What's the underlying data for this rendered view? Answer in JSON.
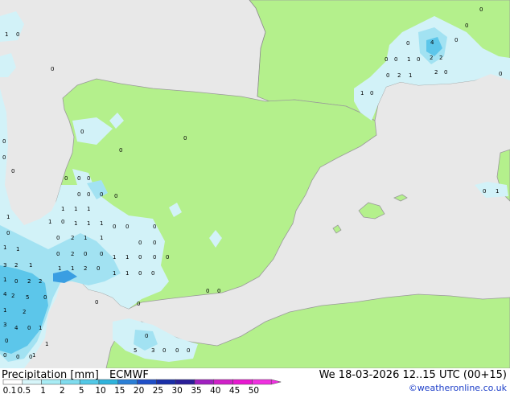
{
  "footer": {
    "title": "Precipitation [mm]",
    "model": "ECMWF",
    "datetime": "We 18-03-2026 12..15 UTC (00+15)",
    "copyright": "©weatheronline.co.uk"
  },
  "legend": {
    "values": [
      "0.1",
      "0.5",
      "1",
      "2",
      "5",
      "10",
      "15",
      "20",
      "25",
      "30",
      "35",
      "40",
      "45",
      "50"
    ],
    "colors": [
      "#ffffff",
      "#d7f5f9",
      "#a8ecf4",
      "#7fdcee",
      "#52c8e6",
      "#2eb3dc",
      "#2a7fd6",
      "#1f4fc8",
      "#1a2fa8",
      "#2a1e98",
      "#a020c0",
      "#d020c8",
      "#e818d0",
      "#f030e0"
    ]
  },
  "colors": {
    "land": "#b4f08c",
    "sea": "#e8e8e8",
    "precip_light": "#d2f2f8",
    "precip_mid": "#a2e2f2",
    "precip_heavy": "#5cc6ea",
    "precip_core": "#3a9ee2"
  },
  "map_values": [
    "1",
    "0",
    "0",
    "0",
    "0",
    "0",
    "0",
    "0",
    "4",
    "0",
    "0",
    "0",
    "0",
    "0",
    "0",
    "1",
    "0",
    "2",
    "2",
    "0",
    "0",
    "2",
    "2",
    "1",
    "1",
    "0",
    "0",
    "0",
    "1",
    "0",
    "0",
    "0",
    "0",
    "0",
    "0",
    "0",
    "1",
    "1",
    "1",
    "1",
    "0",
    "1",
    "1",
    "1",
    "1",
    "0",
    "0",
    "2",
    "1",
    "1",
    "0",
    "0",
    "0",
    "0",
    "0",
    "1",
    "1",
    "0",
    "2",
    "0",
    "0",
    "1",
    "1",
    "0",
    "0",
    "0",
    "1",
    "1",
    "2",
    "0",
    "1",
    "1",
    "0",
    "0",
    "0",
    "0",
    "0",
    "0",
    "1",
    "1",
    "2",
    "3",
    "4",
    "2",
    "0",
    "5",
    "2",
    "2",
    "0",
    "1",
    "2",
    "3",
    "4",
    "0",
    "1",
    "0",
    "0",
    "0",
    "0",
    "5",
    "3",
    "0",
    "0",
    "0",
    "1",
    "0",
    "0",
    "1",
    "4",
    "0"
  ]
}
